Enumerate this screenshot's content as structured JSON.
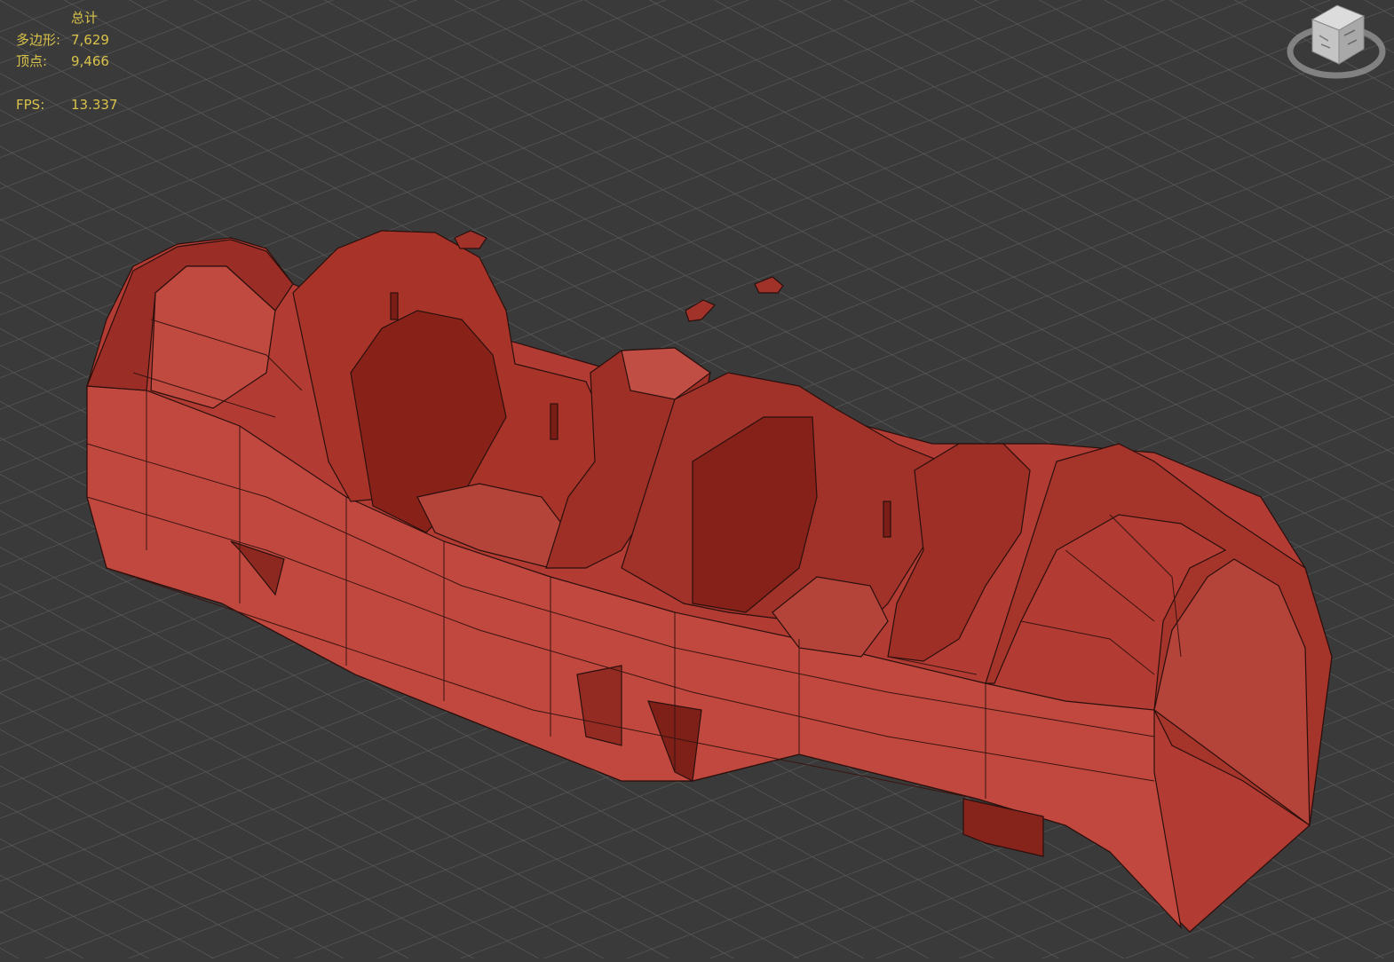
{
  "viewport": {
    "background_color": "#3a3a3a",
    "grid_color": "#5c5c5c",
    "model_color": "#c0483f",
    "model_name": "cockpit-mesh"
  },
  "stats": {
    "header": "总计",
    "polygons_label": "多边形:",
    "polygons_value": "7,629",
    "vertices_label": "顶点:",
    "vertices_value": "9,466",
    "fps_label": "FPS:",
    "fps_value": "13.337",
    "text_color": "#d9c24a"
  },
  "viewcube": {
    "icon": "viewcube-icon"
  }
}
